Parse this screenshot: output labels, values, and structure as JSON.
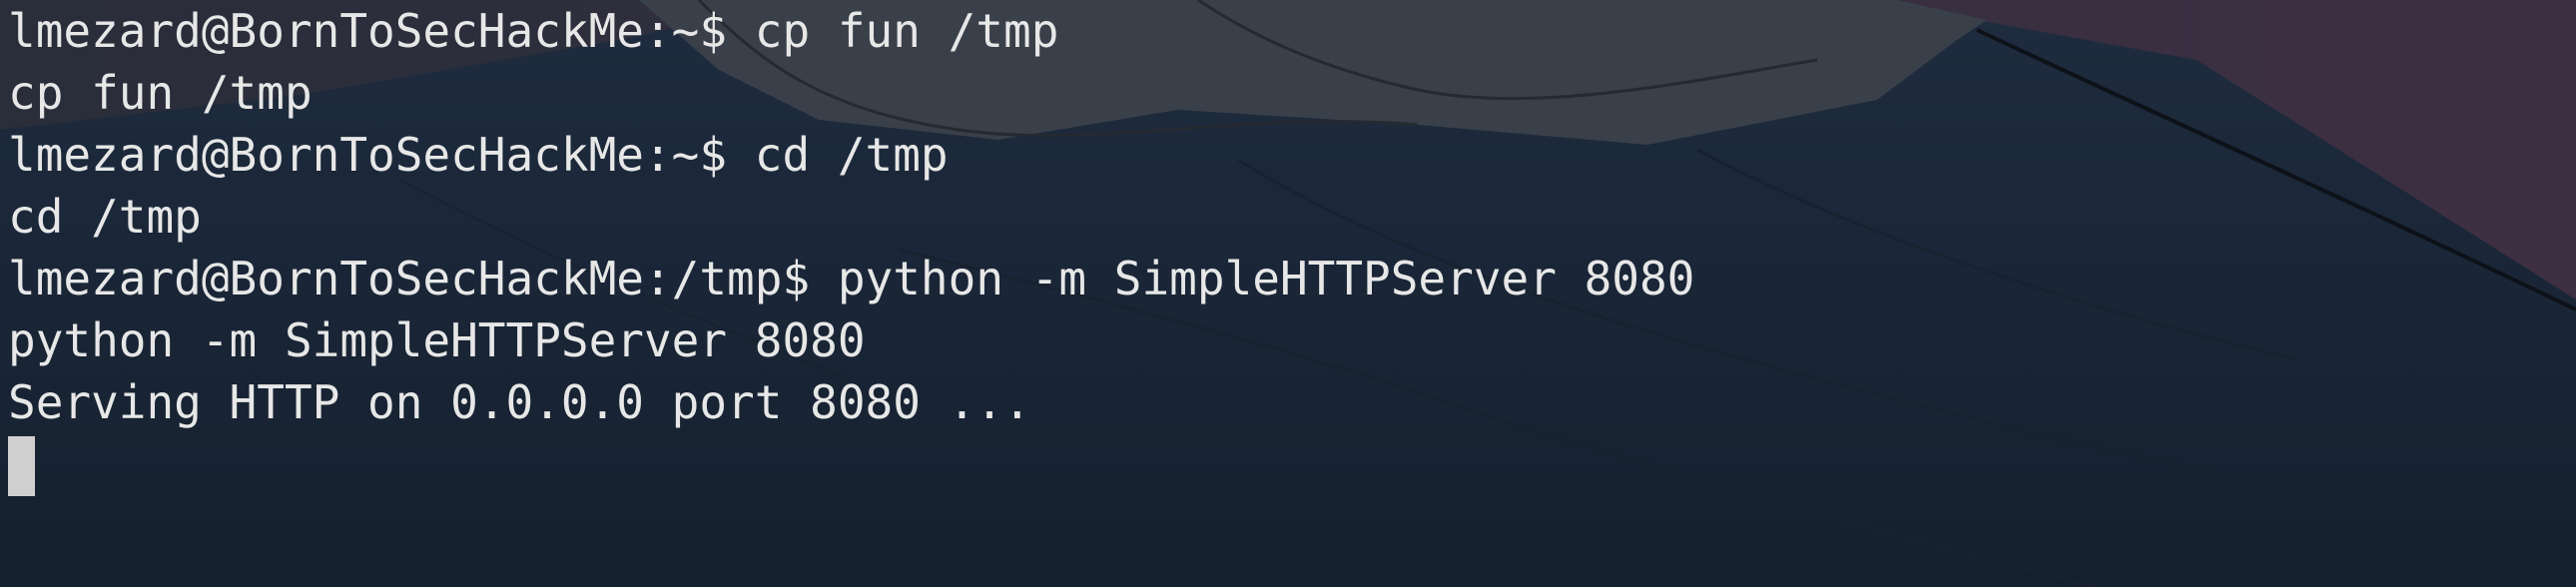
{
  "terminal": {
    "lines": [
      {
        "prompt": "lmezard@BornToSecHackMe:~$ ",
        "text": "cp fun /tmp"
      },
      {
        "prompt": "",
        "text": "cp fun /tmp"
      },
      {
        "prompt": "lmezard@BornToSecHackMe:~$ ",
        "text": "cd /tmp"
      },
      {
        "prompt": "",
        "text": "cd /tmp"
      },
      {
        "prompt": "lmezard@BornToSecHackMe:/tmp$ ",
        "text": "python -m SimpleHTTPServer 8080"
      },
      {
        "prompt": "",
        "text": "python -m SimpleHTTPServer 8080"
      },
      {
        "prompt": "",
        "text": "Serving HTTP on 0.0.0.0 port 8080 ..."
      }
    ]
  },
  "colors": {
    "text": "#e7e7e7",
    "background": "#1b2433",
    "cursor": "#cfcfcf"
  },
  "background_image": "mountain-wallpaper"
}
